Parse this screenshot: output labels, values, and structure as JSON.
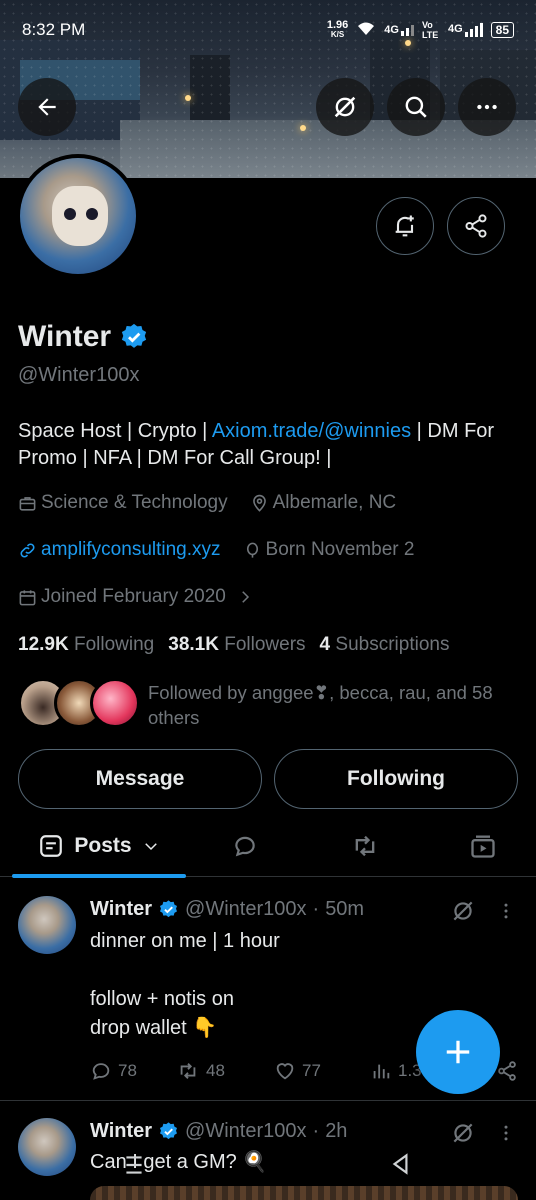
{
  "status_bar": {
    "time": "8:32 PM",
    "speed": "1.96",
    "speed_unit": "K/S",
    "net1": "4G",
    "volte": "Vo LTE",
    "net2": "4G",
    "battery": "85"
  },
  "profile": {
    "name": "Winter",
    "handle": "@Winter100x",
    "bio_prefix": "Space Host | Crypto | ",
    "bio_link": "Axiom.trade/@winnies",
    "bio_suffix": " | DM For Promo | NFA | DM For Call Group! |",
    "category": "Science & Technology",
    "location": "Albemarle, NC",
    "website": "amplifyconsulting.xyz",
    "born": "Born November 2",
    "joined": "Joined February 2020",
    "following_count": "12.9K",
    "following_label": "Following",
    "followers_count": "38.1K",
    "followers_label": "Followers",
    "subs_count": "4",
    "subs_label": "Subscriptions",
    "followed_by": "Followed by anggee❣, becca, rau, and 58 others"
  },
  "buttons": {
    "message": "Message",
    "following": "Following"
  },
  "tabs": {
    "posts": "Posts"
  },
  "tweets": [
    {
      "name": "Winter",
      "handle": "@Winter100x",
      "time": "50m",
      "text": "dinner on me | 1 hour\n\nfollow + notis on\ndrop wallet 👇",
      "replies": "78",
      "retweets": "48",
      "likes": "77",
      "views": "1.3"
    },
    {
      "name": "Winter",
      "handle": "@Winter100x",
      "time": "2h",
      "text": "Can I get a GM? 🍳"
    }
  ],
  "colors": {
    "accent": "#1d9bf0",
    "muted": "#71767b",
    "text": "#e7e9ea",
    "border": "#536471"
  }
}
